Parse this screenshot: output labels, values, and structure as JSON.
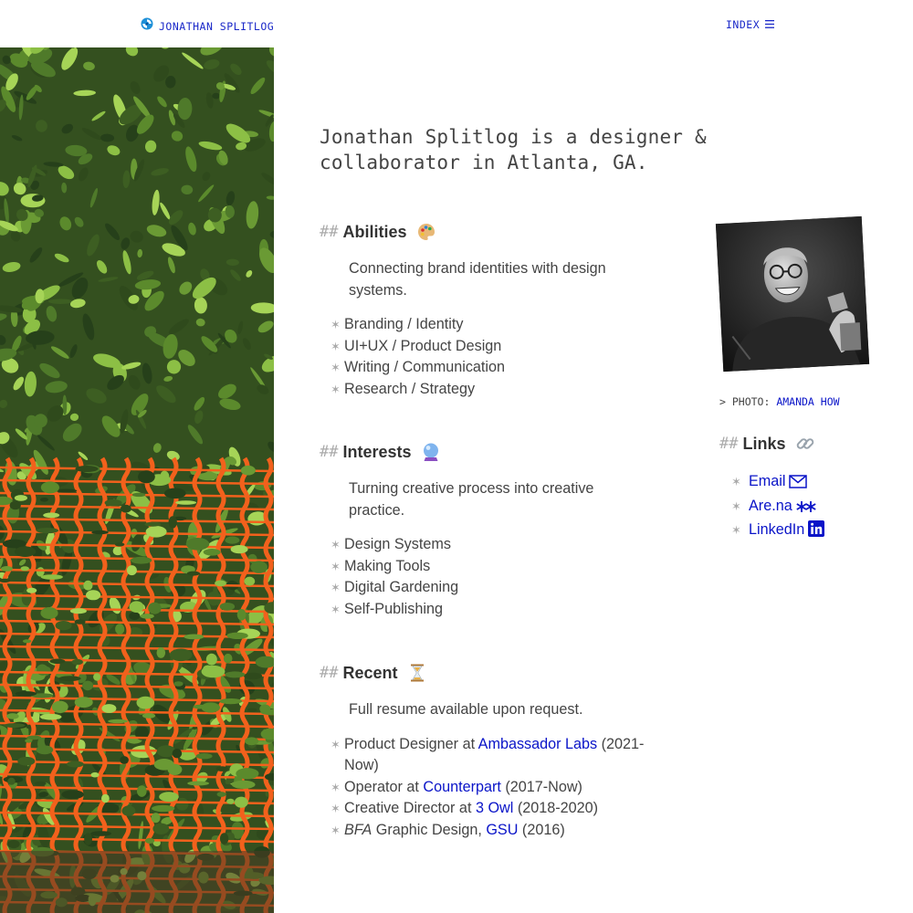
{
  "header": {
    "site_name": "JONATHAN SPLITLOG",
    "nav_label": "INDEX",
    "logo_icon": "swirl-logo-icon",
    "menu_icon": "hamburger-menu-icon",
    "accent_color": "#1a28c8"
  },
  "intro": "Jonathan Splitlog is a designer & collaborator in Atlanta, GA.",
  "sections": {
    "abilities": {
      "hash": "##",
      "title": "Abilities",
      "emoji": "palette-icon",
      "description": "Connecting brand identities with design systems.",
      "items": [
        "Branding / Identity",
        "UI+UX / Product Design",
        "Writing / Communication",
        "Research / Strategy"
      ]
    },
    "interests": {
      "hash": "##",
      "title": "Interests",
      "emoji": "crystal-ball-icon",
      "description": "Turning creative process into creative practice.",
      "items": [
        "Design Systems",
        "Making Tools",
        "Digital Gardening",
        "Self-Publishing"
      ]
    },
    "recent": {
      "hash": "##",
      "title": "Recent",
      "emoji": "hourglass-icon",
      "description": "Full resume available upon request.",
      "items": [
        {
          "pre": "Product Designer at ",
          "link": "Ambassador Labs",
          "post": " (2021-Now)"
        },
        {
          "pre": "Operator at ",
          "link": "Counterpart",
          "post": " (2017-Now)"
        },
        {
          "pre": "Creative Director at ",
          "link": "3 Owl",
          "post": " (2018-2020)"
        },
        {
          "em": "BFA",
          "pre": " Graphic Design, ",
          "link": "GSU",
          "post": " (2016)"
        }
      ]
    }
  },
  "photo_credit": {
    "prefix": "> PHOTO: ",
    "name": "AMANDA HOW"
  },
  "links": {
    "hash": "##",
    "title": "Links",
    "emoji": "link-icon",
    "items": [
      {
        "label": "Email",
        "icon": "envelope-icon"
      },
      {
        "label": "Are.na",
        "icon": "arena-asterisk-icon"
      },
      {
        "label": "LinkedIn",
        "icon": "linkedin-icon"
      }
    ]
  },
  "star_glyph": "✶"
}
